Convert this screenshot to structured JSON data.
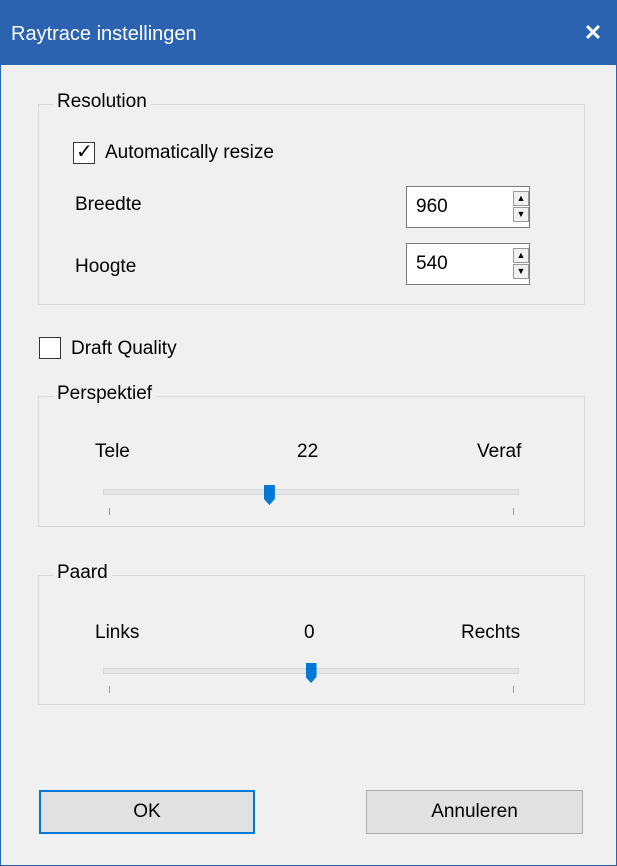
{
  "window": {
    "title": "Raytrace instellingen",
    "close_glyph": "✕"
  },
  "resolution": {
    "legend": "Resolution",
    "auto_resize_label": "Automatically resize",
    "auto_resize_checked": true,
    "width_label": "Breedte",
    "width_value": "960",
    "height_label": "Hoogte",
    "height_value": "540"
  },
  "draft_quality": {
    "label": "Draft Quality",
    "checked": false
  },
  "perspective": {
    "legend": "Perspektief",
    "min_label": "Tele",
    "value_label": "22",
    "max_label": "Veraf",
    "level_fraction": 0.4
  },
  "horse": {
    "legend": "Paard",
    "min_label": "Links",
    "value_label": "0",
    "max_label": "Rechts",
    "level_fraction": 0.5
  },
  "buttons": {
    "ok": "OK",
    "cancel": "Annuleren"
  },
  "colors": {
    "titlebar": "#2b63b0",
    "accent": "#0078d7",
    "dialog_bg": "#f0f0f0"
  },
  "icons": {
    "check": "checkmark-icon",
    "spin_up": "arrow-up-icon",
    "spin_down": "arrow-down-icon"
  }
}
